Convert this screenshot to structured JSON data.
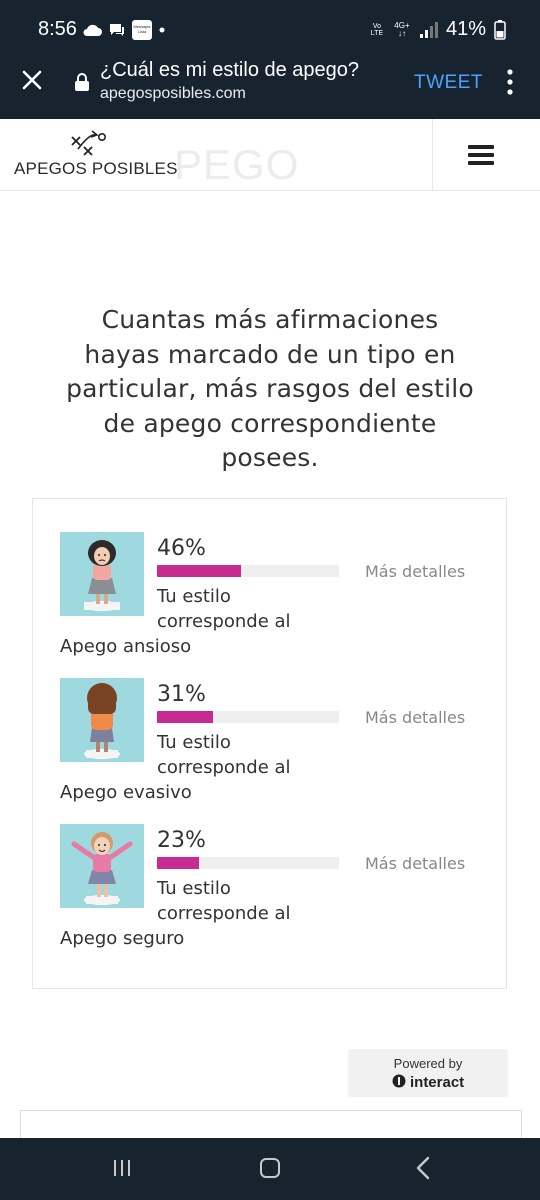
{
  "status_bar": {
    "time": "8:56",
    "battery": "41%",
    "network": "4G+",
    "volte": "Vo LTE",
    "notif_badge": "Mensajes Lista",
    "icons": [
      "cloud-icon",
      "chat-icon",
      "notification-badge-icon",
      "dot-icon",
      "signal-icon",
      "battery-icon"
    ]
  },
  "browser": {
    "title": "¿Cuál es mi estilo de apego?",
    "url": "apegosposibles.com",
    "tweet_label": "TWEET"
  },
  "site": {
    "logo_text": "APEGOS POSIBLES",
    "ghost_text": "PEGO"
  },
  "intro_text": "Cuantas más afirmaciones hayas marcado de un tipo en particular, más rasgos del estilo de apego correspondiente posees.",
  "results": [
    {
      "percent": "46%",
      "value": 46,
      "desc_line": "Tu estilo corresponde al",
      "style": "Apego ansioso",
      "details": "Más detalles"
    },
    {
      "percent": "31%",
      "value": 31,
      "desc_line": "Tu estilo corresponde al",
      "style": "Apego evasivo",
      "details": "Más detalles"
    },
    {
      "percent": "23%",
      "value": 23,
      "desc_line": "Tu estilo corresponde al",
      "style": "Apego seguro",
      "details": "Más detalles"
    }
  ],
  "powered": {
    "line1": "Powered by",
    "line2": "interact"
  },
  "colors": {
    "accent": "#c72b91",
    "bar_bg": "#efefef",
    "dark_bar": "#172430",
    "link": "#4aa3ff",
    "thumb_bg": "#9fd9e0"
  }
}
